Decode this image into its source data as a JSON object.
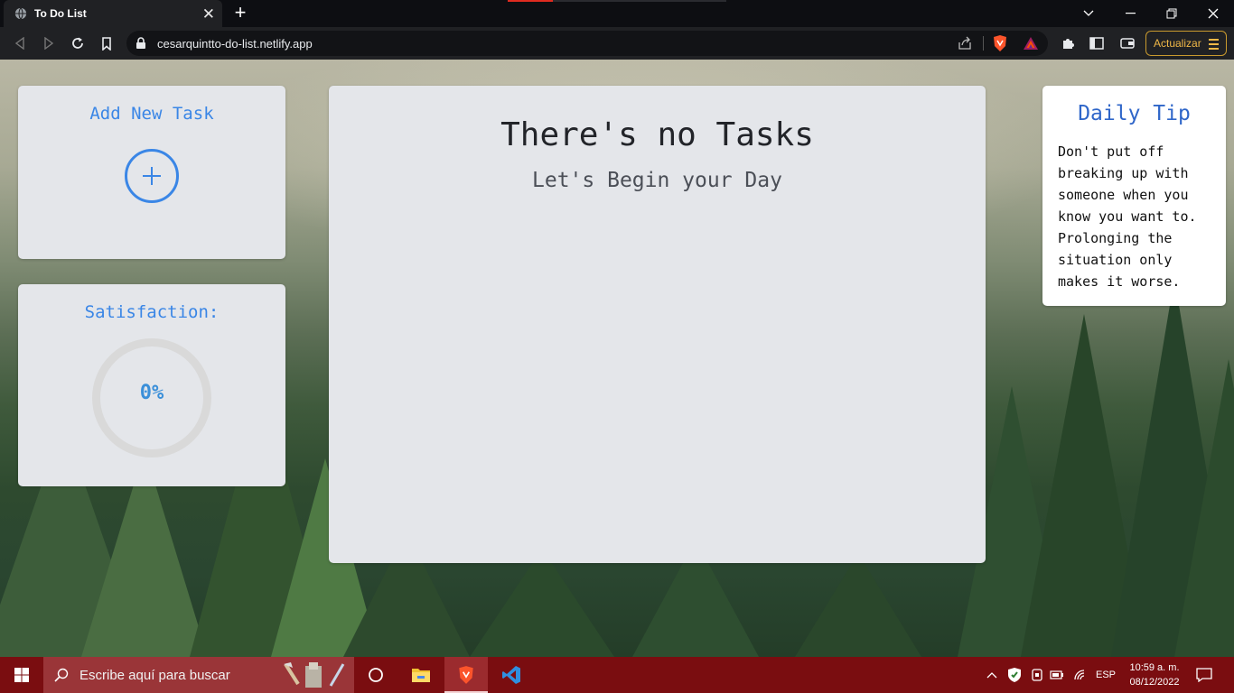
{
  "browser": {
    "tab_title": "To Do List",
    "url": "cesarquintto-do-list.netlify.app",
    "update_label": "Actualizar"
  },
  "app": {
    "add_task_title": "Add New Task",
    "satisfaction_title": "Satisfaction:",
    "satisfaction_value": "0%",
    "empty_title": "There's no Tasks",
    "empty_subtitle": "Let's Begin your Day",
    "tip_title": "Daily Tip",
    "tip_text": "Don't put off breaking up with someone when you know you want to. Prolonging the situation only makes it worse."
  },
  "taskbar": {
    "search_placeholder": "Escribe aquí para buscar",
    "language": "ESP",
    "time": "10:59 a. m.",
    "date": "08/12/2022"
  },
  "icons": {
    "tab": "globe-icon",
    "nav": [
      "back-icon",
      "forward-icon",
      "reload-icon",
      "bookmark-icon"
    ],
    "url": [
      "lock-icon",
      "share-icon",
      "brave-shields-icon",
      "brave-rewards-icon"
    ],
    "toolbar": [
      "extensions-icon",
      "sidebar-icon",
      "wallet-icon",
      "menu-icon"
    ],
    "taskbar": [
      "windows-start-icon",
      "search-icon",
      "cortana-icon",
      "file-explorer-icon",
      "brave-browser-icon",
      "vscode-icon"
    ],
    "tray": [
      "chevron-up-icon",
      "security-icon",
      "device-icon",
      "battery-icon",
      "wifi-icon",
      "notifications-icon"
    ]
  },
  "colors": {
    "accent": "#3a86e6",
    "tip_title": "#2f66c9",
    "taskbar": "#7a0d10",
    "update_button": "#f0b847"
  }
}
